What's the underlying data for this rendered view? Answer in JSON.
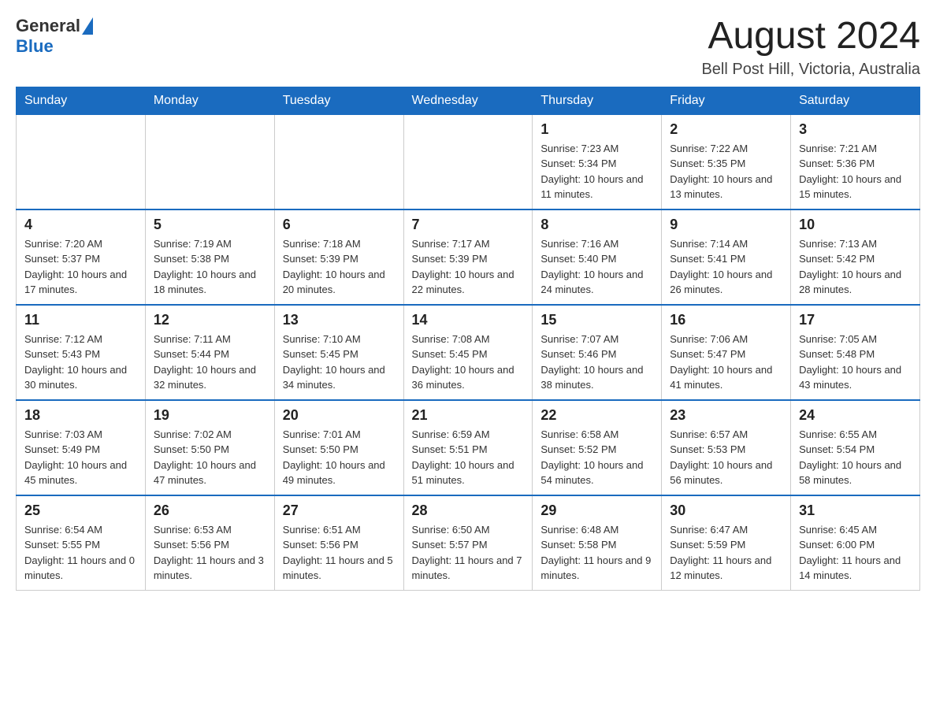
{
  "logo": {
    "text_general": "General",
    "text_blue": "Blue"
  },
  "header": {
    "month_title": "August 2024",
    "location": "Bell Post Hill, Victoria, Australia"
  },
  "weekdays": [
    "Sunday",
    "Monday",
    "Tuesday",
    "Wednesday",
    "Thursday",
    "Friday",
    "Saturday"
  ],
  "weeks": [
    [
      {
        "day": "",
        "sunrise": "",
        "sunset": "",
        "daylight": ""
      },
      {
        "day": "",
        "sunrise": "",
        "sunset": "",
        "daylight": ""
      },
      {
        "day": "",
        "sunrise": "",
        "sunset": "",
        "daylight": ""
      },
      {
        "day": "",
        "sunrise": "",
        "sunset": "",
        "daylight": ""
      },
      {
        "day": "1",
        "sunrise": "Sunrise: 7:23 AM",
        "sunset": "Sunset: 5:34 PM",
        "daylight": "Daylight: 10 hours and 11 minutes."
      },
      {
        "day": "2",
        "sunrise": "Sunrise: 7:22 AM",
        "sunset": "Sunset: 5:35 PM",
        "daylight": "Daylight: 10 hours and 13 minutes."
      },
      {
        "day": "3",
        "sunrise": "Sunrise: 7:21 AM",
        "sunset": "Sunset: 5:36 PM",
        "daylight": "Daylight: 10 hours and 15 minutes."
      }
    ],
    [
      {
        "day": "4",
        "sunrise": "Sunrise: 7:20 AM",
        "sunset": "Sunset: 5:37 PM",
        "daylight": "Daylight: 10 hours and 17 minutes."
      },
      {
        "day": "5",
        "sunrise": "Sunrise: 7:19 AM",
        "sunset": "Sunset: 5:38 PM",
        "daylight": "Daylight: 10 hours and 18 minutes."
      },
      {
        "day": "6",
        "sunrise": "Sunrise: 7:18 AM",
        "sunset": "Sunset: 5:39 PM",
        "daylight": "Daylight: 10 hours and 20 minutes."
      },
      {
        "day": "7",
        "sunrise": "Sunrise: 7:17 AM",
        "sunset": "Sunset: 5:39 PM",
        "daylight": "Daylight: 10 hours and 22 minutes."
      },
      {
        "day": "8",
        "sunrise": "Sunrise: 7:16 AM",
        "sunset": "Sunset: 5:40 PM",
        "daylight": "Daylight: 10 hours and 24 minutes."
      },
      {
        "day": "9",
        "sunrise": "Sunrise: 7:14 AM",
        "sunset": "Sunset: 5:41 PM",
        "daylight": "Daylight: 10 hours and 26 minutes."
      },
      {
        "day": "10",
        "sunrise": "Sunrise: 7:13 AM",
        "sunset": "Sunset: 5:42 PM",
        "daylight": "Daylight: 10 hours and 28 minutes."
      }
    ],
    [
      {
        "day": "11",
        "sunrise": "Sunrise: 7:12 AM",
        "sunset": "Sunset: 5:43 PM",
        "daylight": "Daylight: 10 hours and 30 minutes."
      },
      {
        "day": "12",
        "sunrise": "Sunrise: 7:11 AM",
        "sunset": "Sunset: 5:44 PM",
        "daylight": "Daylight: 10 hours and 32 minutes."
      },
      {
        "day": "13",
        "sunrise": "Sunrise: 7:10 AM",
        "sunset": "Sunset: 5:45 PM",
        "daylight": "Daylight: 10 hours and 34 minutes."
      },
      {
        "day": "14",
        "sunrise": "Sunrise: 7:08 AM",
        "sunset": "Sunset: 5:45 PM",
        "daylight": "Daylight: 10 hours and 36 minutes."
      },
      {
        "day": "15",
        "sunrise": "Sunrise: 7:07 AM",
        "sunset": "Sunset: 5:46 PM",
        "daylight": "Daylight: 10 hours and 38 minutes."
      },
      {
        "day": "16",
        "sunrise": "Sunrise: 7:06 AM",
        "sunset": "Sunset: 5:47 PM",
        "daylight": "Daylight: 10 hours and 41 minutes."
      },
      {
        "day": "17",
        "sunrise": "Sunrise: 7:05 AM",
        "sunset": "Sunset: 5:48 PM",
        "daylight": "Daylight: 10 hours and 43 minutes."
      }
    ],
    [
      {
        "day": "18",
        "sunrise": "Sunrise: 7:03 AM",
        "sunset": "Sunset: 5:49 PM",
        "daylight": "Daylight: 10 hours and 45 minutes."
      },
      {
        "day": "19",
        "sunrise": "Sunrise: 7:02 AM",
        "sunset": "Sunset: 5:50 PM",
        "daylight": "Daylight: 10 hours and 47 minutes."
      },
      {
        "day": "20",
        "sunrise": "Sunrise: 7:01 AM",
        "sunset": "Sunset: 5:50 PM",
        "daylight": "Daylight: 10 hours and 49 minutes."
      },
      {
        "day": "21",
        "sunrise": "Sunrise: 6:59 AM",
        "sunset": "Sunset: 5:51 PM",
        "daylight": "Daylight: 10 hours and 51 minutes."
      },
      {
        "day": "22",
        "sunrise": "Sunrise: 6:58 AM",
        "sunset": "Sunset: 5:52 PM",
        "daylight": "Daylight: 10 hours and 54 minutes."
      },
      {
        "day": "23",
        "sunrise": "Sunrise: 6:57 AM",
        "sunset": "Sunset: 5:53 PM",
        "daylight": "Daylight: 10 hours and 56 minutes."
      },
      {
        "day": "24",
        "sunrise": "Sunrise: 6:55 AM",
        "sunset": "Sunset: 5:54 PM",
        "daylight": "Daylight: 10 hours and 58 minutes."
      }
    ],
    [
      {
        "day": "25",
        "sunrise": "Sunrise: 6:54 AM",
        "sunset": "Sunset: 5:55 PM",
        "daylight": "Daylight: 11 hours and 0 minutes."
      },
      {
        "day": "26",
        "sunrise": "Sunrise: 6:53 AM",
        "sunset": "Sunset: 5:56 PM",
        "daylight": "Daylight: 11 hours and 3 minutes."
      },
      {
        "day": "27",
        "sunrise": "Sunrise: 6:51 AM",
        "sunset": "Sunset: 5:56 PM",
        "daylight": "Daylight: 11 hours and 5 minutes."
      },
      {
        "day": "28",
        "sunrise": "Sunrise: 6:50 AM",
        "sunset": "Sunset: 5:57 PM",
        "daylight": "Daylight: 11 hours and 7 minutes."
      },
      {
        "day": "29",
        "sunrise": "Sunrise: 6:48 AM",
        "sunset": "Sunset: 5:58 PM",
        "daylight": "Daylight: 11 hours and 9 minutes."
      },
      {
        "day": "30",
        "sunrise": "Sunrise: 6:47 AM",
        "sunset": "Sunset: 5:59 PM",
        "daylight": "Daylight: 11 hours and 12 minutes."
      },
      {
        "day": "31",
        "sunrise": "Sunrise: 6:45 AM",
        "sunset": "Sunset: 6:00 PM",
        "daylight": "Daylight: 11 hours and 14 minutes."
      }
    ]
  ]
}
